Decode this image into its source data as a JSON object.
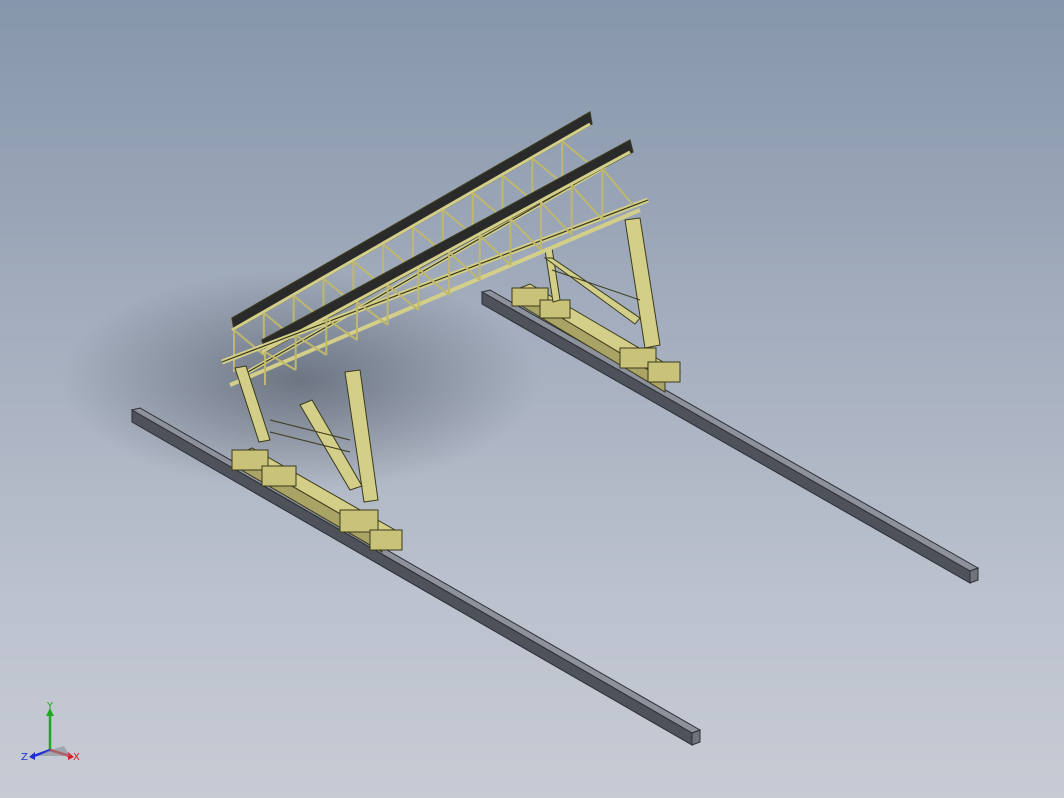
{
  "viewport": {
    "background_top": "#8696ab",
    "background_bottom": "#c7cbd4"
  },
  "model": {
    "structure_color": "#d4cf88",
    "structure_outline": "#3a3a1c",
    "rail_color": "#6f7480"
  },
  "triad": {
    "x_label": "X",
    "y_label": "Y",
    "z_label": "Z",
    "x_color": "#d42020",
    "y_color": "#1fa81f",
    "z_color": "#2030d0"
  }
}
